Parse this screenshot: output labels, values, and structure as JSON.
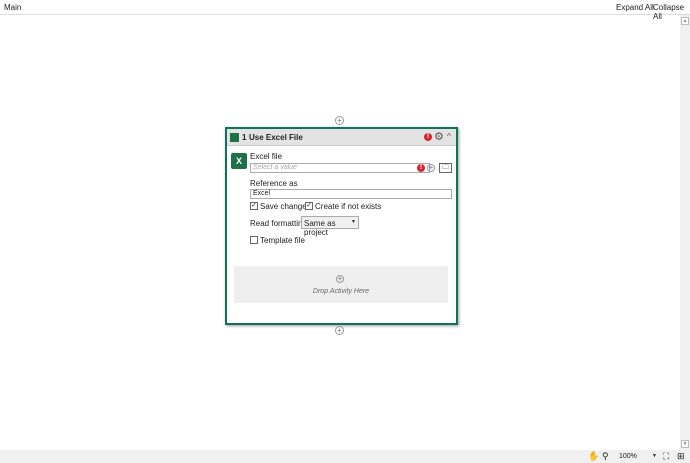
{
  "header": {
    "title": "Main",
    "expand_all": "Expand All",
    "collapse_all": "Collapse All"
  },
  "activity": {
    "index": "1",
    "title": "Use Excel File",
    "excel_file_label": "Excel file",
    "excel_file_placeholder": "Select a value",
    "reference_label": "Reference as",
    "reference_value": "Excel",
    "save_changes": "Save changes",
    "save_changes_checked": true,
    "create_if_not_exists": "Create if not exists",
    "create_checked": true,
    "read_formatting_label": "Read formatting",
    "read_formatting_value": "Same as project",
    "template_file": "Template file",
    "template_checked": false,
    "drop_text": "Drop Activity Here",
    "excel_icon_letter": "X"
  },
  "statusbar": {
    "zoom": "100%"
  },
  "colors": {
    "accent": "#11715f",
    "error": "#d9242b"
  }
}
